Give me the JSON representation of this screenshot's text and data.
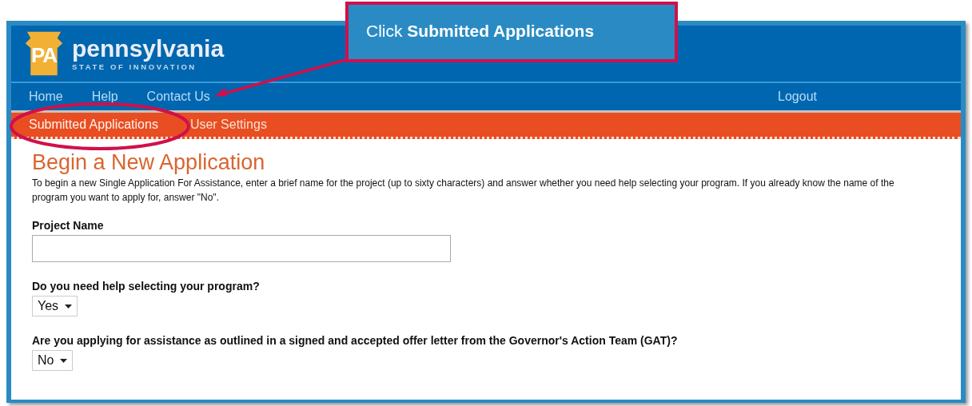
{
  "callout": {
    "prefix": "Click ",
    "target": "Submitted Applications"
  },
  "header": {
    "logo_mark": "PA",
    "logo_title": "pennsylvania",
    "logo_tagline": "STATE OF INNOVATION"
  },
  "nav": {
    "links": [
      "Home",
      "Help",
      "Contact Us"
    ],
    "right_link": "Logout"
  },
  "subnav": {
    "links": [
      {
        "label": "Submitted Applications",
        "highlighted": true
      },
      {
        "label": "User Settings",
        "highlighted": false
      }
    ]
  },
  "page": {
    "title": "Begin a New Application",
    "intro": "To begin a new Single Application For Assistance, enter a brief name for the project (up to sixty characters) and answer whether you need help selecting your program. If you already know the name of the program you want to apply for, answer \"No\".",
    "fields": [
      {
        "kind": "text",
        "label": "Project Name"
      },
      {
        "kind": "select",
        "label": "Do you need help selecting your program?",
        "value": "Yes"
      },
      {
        "kind": "select",
        "label": "Are you applying for assistance as outlined in a signed and accepted offer letter from the Governor's Action Team (GAT)?",
        "value": "No"
      }
    ]
  }
}
